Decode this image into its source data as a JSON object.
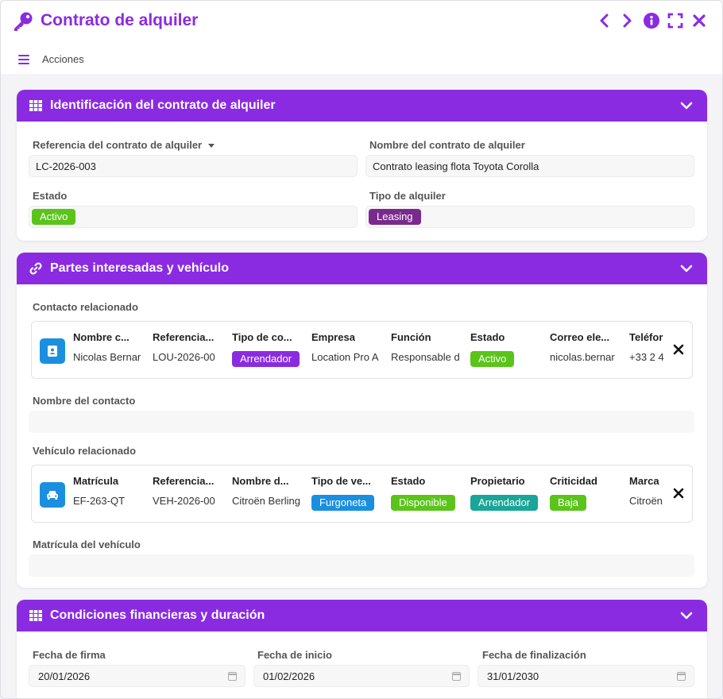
{
  "window": {
    "title": "Contrato de alquiler"
  },
  "toolbar": {
    "actions_label": "Acciones"
  },
  "colors": {
    "accent": "#8a2be2",
    "green": "#5ac41a",
    "purple_dark": "#7a2a8c",
    "violet": "#8a2be2",
    "blue": "#1a8fe0",
    "teal": "#19a598"
  },
  "sections": {
    "identificacion": {
      "title": "Identificación del contrato de alquiler",
      "ref_label": "Referencia del contrato de alquiler",
      "ref_value": "LC-2026-003",
      "name_label": "Nombre del contrato de alquiler",
      "name_value": "Contrato leasing flota Toyota Corolla",
      "estado_label": "Estado",
      "estado_value": "Activo",
      "tipo_label": "Tipo de alquiler",
      "tipo_value": "Leasing"
    },
    "partes": {
      "title": "Partes interesadas y vehículo",
      "contacto_label": "Contacto relacionado",
      "contacto_headers": [
        "Nombre c...",
        "Referencia...",
        "Tipo de co...",
        "Empresa",
        "Función",
        "Estado",
        "Correo ele...",
        "Teléfor"
      ],
      "contacto_values": [
        "Nicolas Bernar",
        "LOU-2026-00",
        "Arrendador",
        "Location Pro A",
        "Responsable d",
        "Activo",
        "nicolas.bernar",
        "+33 2 4"
      ],
      "nombre_contacto_label": "Nombre del contacto",
      "nombre_contacto_value": "",
      "vehiculo_label": "Vehículo relacionado",
      "vehiculo_headers": [
        "Matrícula",
        "Referencia...",
        "Nombre d...",
        "Tipo de ve...",
        "Estado",
        "Propietario",
        "Criticidad",
        "Marca"
      ],
      "vehiculo_values": [
        "EF-263-QT",
        "VEH-2026-00",
        "Citroën Berling",
        "Furgoneta",
        "Disponible",
        "Arrendador",
        "Baja",
        "Citroën"
      ],
      "matricula_label": "Matrícula del vehículo",
      "matricula_value": ""
    },
    "condiciones": {
      "title": "Condiciones financieras y duración",
      "firma_label": "Fecha de firma",
      "firma_value": "20/01/2026",
      "inicio_label": "Fecha de inicio",
      "inicio_value": "01/02/2026",
      "fin_label": "Fecha de finalización",
      "fin_value": "31/01/2030"
    }
  }
}
